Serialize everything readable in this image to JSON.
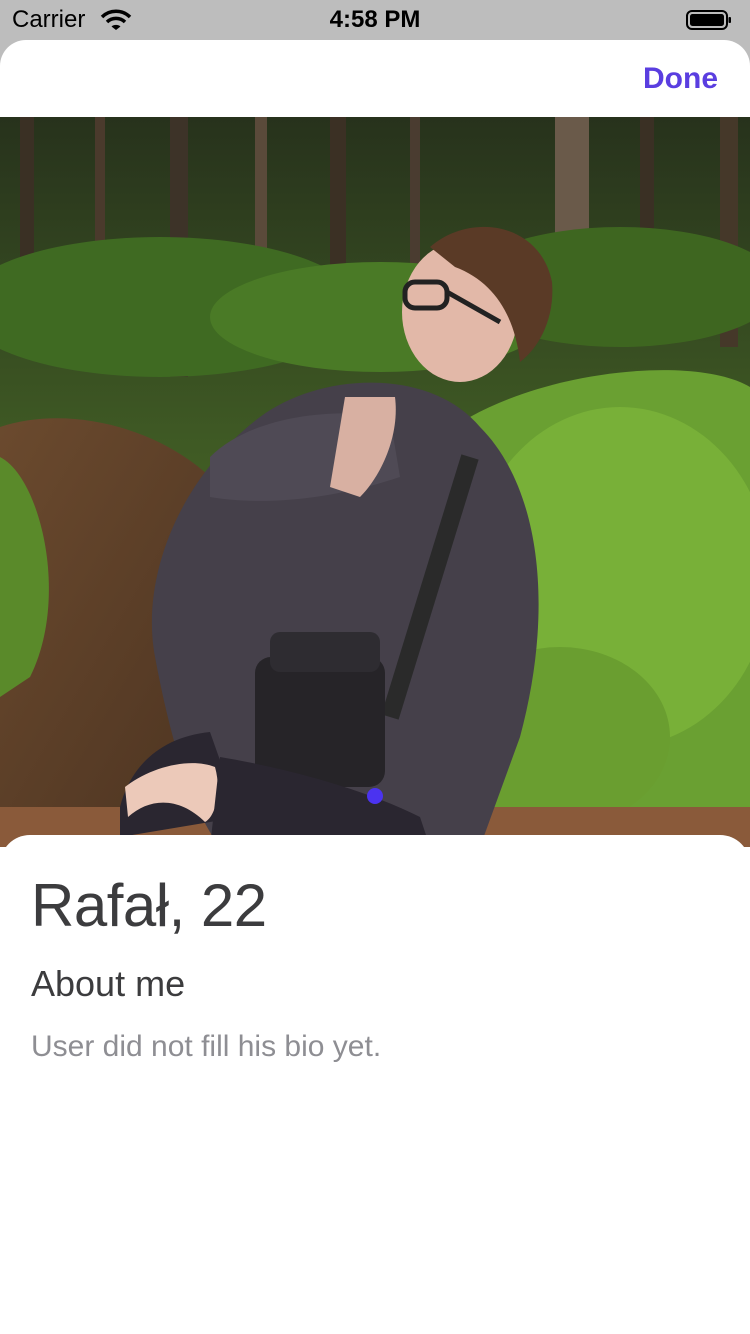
{
  "status_bar": {
    "carrier": "Carrier",
    "time": "4:58 PM",
    "wifi_icon": "wifi-icon",
    "battery_icon": "battery-icon"
  },
  "header": {
    "done_label": "Done",
    "accent_color": "#5a3ee0"
  },
  "photo": {
    "description_icon": "profile-photo",
    "page_index": 1,
    "page_count": 1,
    "dot_color": "#4b33f0"
  },
  "profile": {
    "name_age": "Rafał, 22",
    "about_heading": "About me",
    "bio": "User did not fill his bio yet."
  }
}
